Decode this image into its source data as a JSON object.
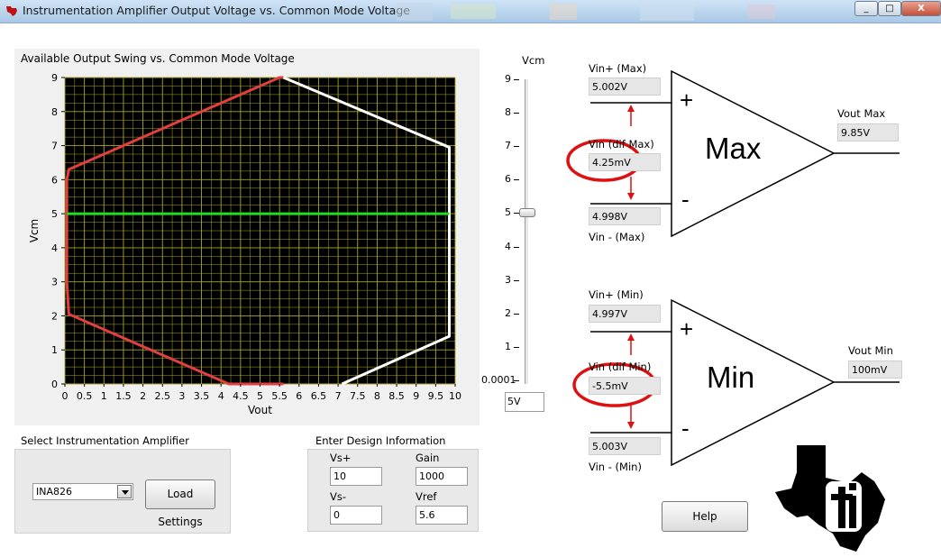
{
  "window": {
    "title": "Instrumentation Amplifier Output Voltage vs. Common Mode Voltage",
    "minimize_glyph": "_",
    "maximize_glyph": "□",
    "close_glyph": "X"
  },
  "graph": {
    "title": "Available Output Swing vs. Common Mode Voltage"
  },
  "chart_data": {
    "type": "line",
    "title": "Available Output Swing vs. Common Mode Voltage",
    "xlabel": "Vout",
    "ylabel": "Vcm",
    "xlim": [
      0,
      10
    ],
    "ylim": [
      0,
      9
    ],
    "x_ticks": [
      "0",
      "0.5",
      "1",
      "1.5",
      "2",
      "2.5",
      "3",
      "3.5",
      "4",
      "4.5",
      "5",
      "5.5",
      "6",
      "6.5",
      "7",
      "7.5",
      "8",
      "8.5",
      "9",
      "9.5",
      "10"
    ],
    "y_ticks": [
      "0",
      "1",
      "2",
      "3",
      "4",
      "5",
      "6",
      "7",
      "8",
      "9"
    ],
    "grid": true,
    "background": "#000000",
    "grid_color": "#a8a820",
    "series": [
      {
        "color": "#e04040",
        "x": [
          4.3,
          4.2,
          0.1,
          0.05,
          0.05,
          0.1,
          5.5,
          5.6
        ],
        "y": [
          0.0,
          0.0,
          2.05,
          3.0,
          6.0,
          6.3,
          9.0,
          9.0
        ]
      },
      {
        "color": "#e04040",
        "x": [
          4.2,
          5.6
        ],
        "y": [
          0.0,
          0.0
        ]
      },
      {
        "color": "#ffffff",
        "x": [
          5.6,
          9.85,
          9.85,
          7.1
        ],
        "y": [
          9.0,
          6.95,
          1.4,
          0.0
        ]
      },
      {
        "color": "#22dd22",
        "x": [
          0.05,
          9.85
        ],
        "y": [
          5.0,
          5.0
        ]
      }
    ]
  },
  "slider": {
    "title": "Vcm",
    "ticks": [
      "9",
      "8",
      "7",
      "6",
      "5",
      "4",
      "3",
      "2",
      "1",
      "0.0001"
    ],
    "value": "5V",
    "level": 5
  },
  "max_amp": {
    "vin_plus_label": "Vin+ (Max)",
    "vin_plus_value": "5.002V",
    "vin_dif_label": "Vin (dif Max)",
    "vin_dif_value": "4.25mV",
    "vin_minus_label": "Vin - (Max)",
    "vin_minus_value": "4.998V",
    "vout_label": "Vout Max",
    "vout_value": "9.85V",
    "name": "Max",
    "plus_sign": "+",
    "minus_sign": "-"
  },
  "min_amp": {
    "vin_plus_label": "Vin+ (Min)",
    "vin_plus_value": "4.997V",
    "vin_dif_label": "Vin (dif Min)",
    "vin_dif_value": "-5.5mV",
    "vin_minus_label": "Vin - (Min)",
    "vin_minus_value": "5.003V",
    "vout_label": "Vout Min",
    "vout_value": "100mV",
    "name": "Min",
    "plus_sign": "+",
    "minus_sign": "-"
  },
  "select_panel": {
    "title": "Select Instrumentation Amplifier",
    "selected": "INA826",
    "load_button": "Load Settings"
  },
  "design_panel": {
    "title": "Enter Design Information",
    "vs_plus_label": "Vs+",
    "vs_plus_value": "10",
    "gain_label": "Gain",
    "gain_value": "1000",
    "vs_minus_label": "Vs-",
    "vs_minus_value": "0",
    "vref_label": "Vref",
    "vref_value": "5.6"
  },
  "help_button": "Help",
  "colors": {
    "highlight_circle": "#dd1111",
    "arrow": "#dd1111",
    "ti_logo": "#000000"
  }
}
